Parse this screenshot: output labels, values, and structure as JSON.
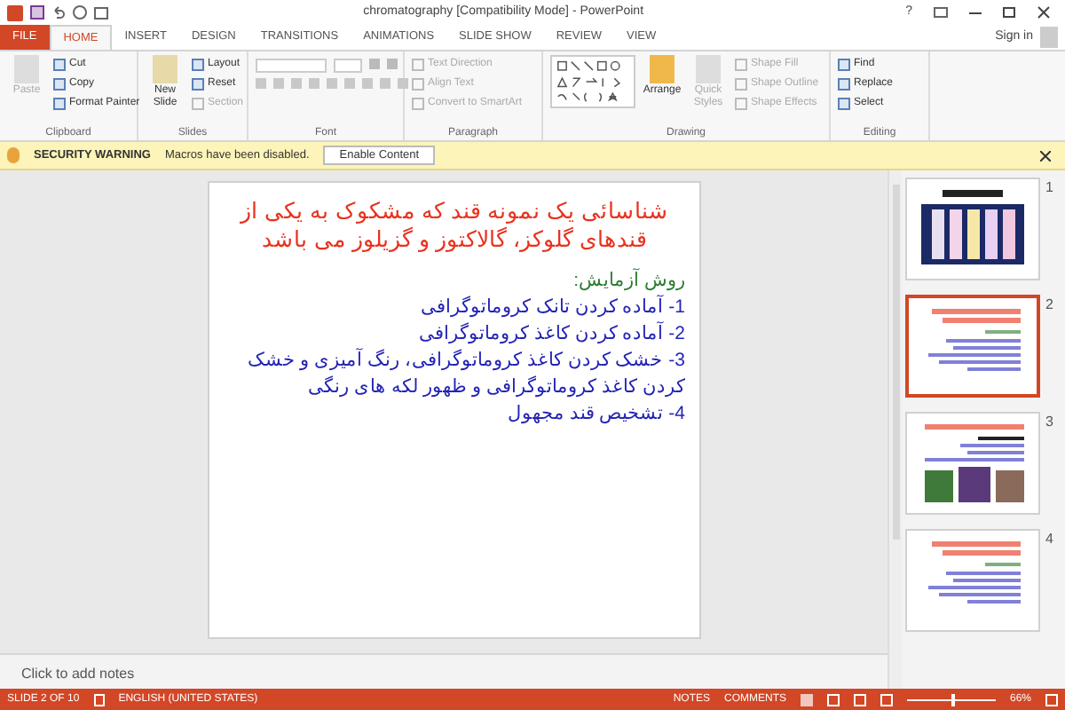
{
  "window": {
    "title": "chromatography [Compatibility Mode] - PowerPoint",
    "help": "?",
    "sign_in": "Sign in"
  },
  "tabs": [
    {
      "label": "FILE",
      "kind": "file",
      "selected": false
    },
    {
      "label": "HOME",
      "kind": "tab",
      "selected": true
    },
    {
      "label": "INSERT",
      "kind": "tab",
      "selected": false
    },
    {
      "label": "DESIGN",
      "kind": "tab",
      "selected": false
    },
    {
      "label": "TRANSITIONS",
      "kind": "tab",
      "selected": false
    },
    {
      "label": "ANIMATIONS",
      "kind": "tab",
      "selected": false
    },
    {
      "label": "SLIDE SHOW",
      "kind": "tab",
      "selected": false
    },
    {
      "label": "REVIEW",
      "kind": "tab",
      "selected": false
    },
    {
      "label": "VIEW",
      "kind": "tab",
      "selected": false
    }
  ],
  "ribbon": {
    "groups": [
      {
        "label": "Clipboard",
        "buttons": [
          {
            "label": "Paste",
            "disabled": true
          }
        ],
        "items": [
          {
            "label": "Cut",
            "disabled": false
          },
          {
            "label": "Copy",
            "disabled": false
          },
          {
            "label": "Format Painter",
            "disabled": false
          }
        ]
      },
      {
        "label": "Slides",
        "buttons": [
          {
            "label": "New Slide",
            "disabled": false
          }
        ],
        "items": [
          {
            "label": "Layout",
            "disabled": false
          },
          {
            "label": "Reset",
            "disabled": false
          },
          {
            "label": "Section",
            "disabled": true
          }
        ]
      },
      {
        "label": "Font",
        "kind": "font"
      },
      {
        "label": "Paragraph",
        "kind": "paragraph",
        "items": [
          {
            "label": "Text Direction",
            "disabled": true
          },
          {
            "label": "Align Text",
            "disabled": true
          },
          {
            "label": "Convert to SmartArt",
            "disabled": true
          }
        ]
      },
      {
        "label": "Drawing",
        "kind": "drawing",
        "buttons": [
          {
            "label": "Arrange",
            "disabled": false
          },
          {
            "label": "Quick Styles",
            "disabled": true
          }
        ],
        "items": [
          {
            "label": "Shape Fill",
            "disabled": true
          },
          {
            "label": "Shape Outline",
            "disabled": true
          },
          {
            "label": "Shape Effects",
            "disabled": true
          }
        ]
      },
      {
        "label": "Editing",
        "items": [
          {
            "label": "Find",
            "disabled": false
          },
          {
            "label": "Replace",
            "disabled": false
          },
          {
            "label": "Select",
            "disabled": false
          }
        ]
      }
    ]
  },
  "security_bar": {
    "title": "SECURITY WARNING",
    "message": "Macros have been disabled.",
    "button": "Enable Content"
  },
  "slide": {
    "title": "شناسائی یک نمونه قند که مشکوک به یکی از قندهای گلوکز، گالاکتوز و گزیلوز می باشد",
    "subtitle": "روش آزمایش:",
    "steps": [
      "1- آماده کردن تانک کروماتوگرافی",
      "2- آماده کردن کاغذ کروماتوگرافی",
      "3-  خشک کردن کاغذ کروماتوگرافی، رنگ آمیزی و خشک کردن کاغذ کروماتوگرافی و ظهور لکه های رنگی",
      "4- تشخیص قند مجهول"
    ]
  },
  "thumbnails": [
    {
      "number": "1",
      "kind": "image",
      "selected": false
    },
    {
      "number": "2",
      "kind": "text",
      "selected": true
    },
    {
      "number": "3",
      "kind": "mixed",
      "selected": false
    },
    {
      "number": "4",
      "kind": "text",
      "selected": false
    }
  ],
  "notes": {
    "placeholder": "Click to add notes"
  },
  "status_bar": {
    "slide": "SLIDE 2 OF 10",
    "language": "ENGLISH (UNITED STATES)",
    "notes": "NOTES",
    "comments": "COMMENTS",
    "zoom": "66%",
    "level": 0.5
  }
}
